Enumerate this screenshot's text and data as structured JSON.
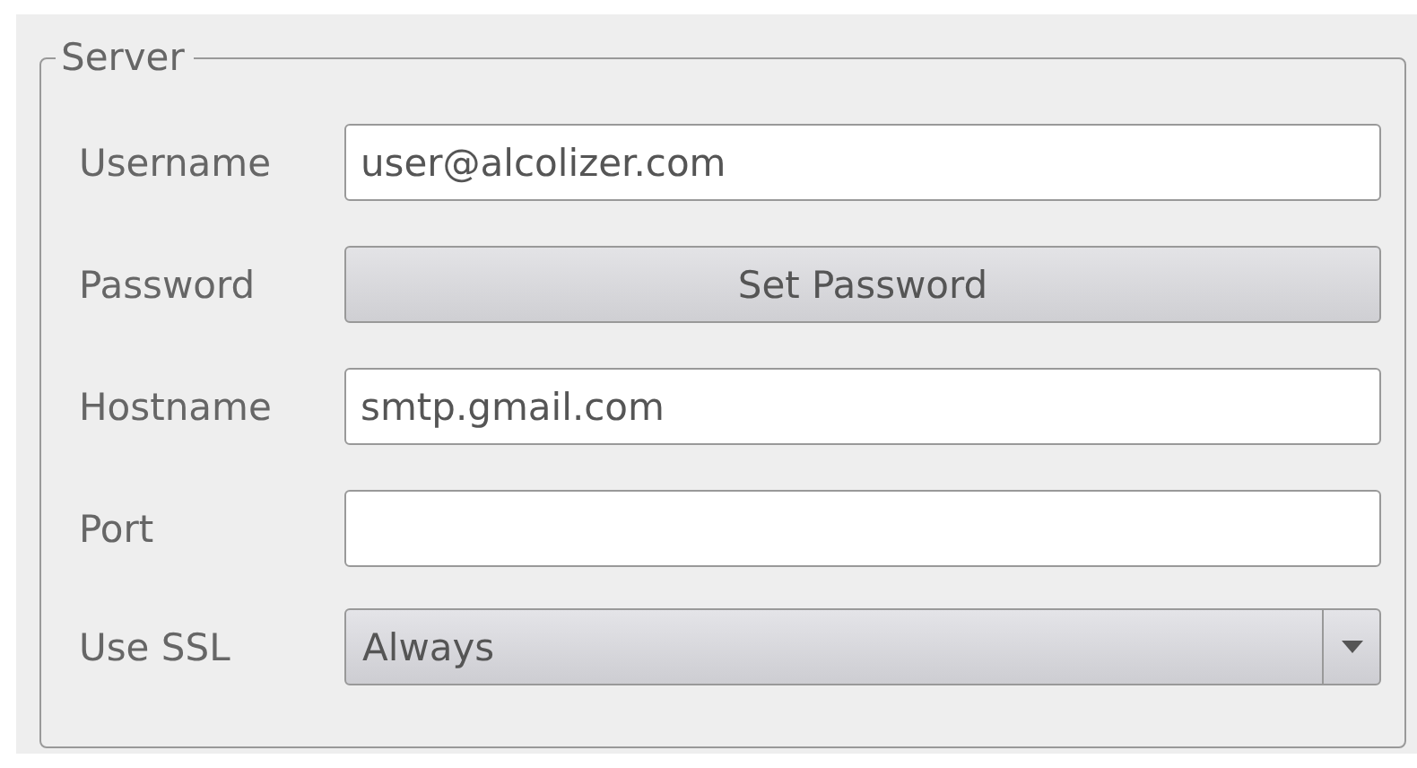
{
  "group": {
    "title": "Server"
  },
  "rows": [
    {
      "kind": "text",
      "label": "Username",
      "value": "user@alcolizer.com"
    },
    {
      "kind": "button",
      "label": "Password",
      "value": "Set Password"
    },
    {
      "kind": "text",
      "label": "Hostname",
      "value": "smtp.gmail.com"
    },
    {
      "kind": "text",
      "label": "Port"
    },
    {
      "kind": "select",
      "label": "Use SSL",
      "value": "Always"
    }
  ]
}
